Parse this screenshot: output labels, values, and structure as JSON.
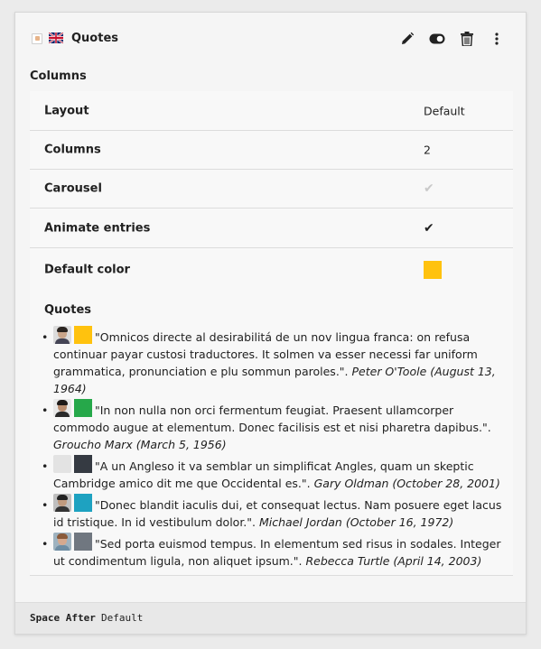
{
  "element": {
    "title": "Quotes",
    "type_icon": "content-element-icon",
    "language_flag": "uk-flag-icon"
  },
  "actions": [
    {
      "name": "edit-icon"
    },
    {
      "name": "toggle-visibility-icon"
    },
    {
      "name": "delete-icon"
    },
    {
      "name": "more-icon"
    }
  ],
  "section_label": "Columns",
  "settings": {
    "layout": {
      "label": "Layout",
      "value": "Default"
    },
    "columns": {
      "label": "Columns",
      "value": "2"
    },
    "carousel": {
      "label": "Carousel",
      "state": "unchecked"
    },
    "animate": {
      "label": "Animate entries",
      "state": "checked"
    },
    "default_color": {
      "label": "Default color",
      "color": "#FFC20E"
    }
  },
  "quotes": {
    "title": "Quotes",
    "items": [
      {
        "avatar": {
          "skin": "#c9a58a",
          "hair": "#2a2420",
          "body": "#445",
          "bg": "#dcdcdc"
        },
        "color": "#FFC20E",
        "text": "\"Omnicos directe al desirabilitá de un nov lingua franca: on refusa continuar payar custosi traductores. It solmen va esser necessi far uniform grammatica, pronunciation e plu sommun paroles.\".",
        "author": "Peter O'Toole (August 13, 1964)"
      },
      {
        "avatar": {
          "skin": "#b88c6e",
          "hair": "#1e1a18",
          "body": "#2a2a2a",
          "bg": "#e8e8e8"
        },
        "color": "#26A84A",
        "text": "\"In non nulla non orci fermentum feugiat. Praesent ullamcorper commodo augue at elementum. Donec facilisis est et nisi pharetra dapibus.\".",
        "author": "Groucho Marx (March 5, 1956)"
      },
      {
        "avatar": null,
        "color": "#353A42",
        "text": "\"A un Angleso it va semblar un simplificat Angles, quam un skeptic Cambridge amico dit me que Occidental es.\".",
        "author": "Gary Oldman (October 28, 2001)"
      },
      {
        "avatar": {
          "skin": "#c09a7e",
          "hair": "#222",
          "body": "#333",
          "bg": "#bfbfbf"
        },
        "color": "#1EA2C1",
        "text": "\"Donec blandit iaculis dui, et consequat lectus. Nam posuere eget lacus id tristique. In id vestibulum dolor.\".",
        "author": "Michael Jordan (October 16, 1972)"
      },
      {
        "avatar": {
          "skin": "#d6a98e",
          "hair": "#8a5a3a",
          "body": "#6e8da3",
          "bg": "#9fb3c0"
        },
        "color": "#707780",
        "text": "\"Sed porta euismod tempus. In elementum sed risus in sodales. Integer ut condimentum ligula, non aliquet ipsum.\".",
        "author": "Rebecca Turtle (April 14, 2003)"
      }
    ]
  },
  "footer": {
    "key": "Space After",
    "value": "Default"
  }
}
